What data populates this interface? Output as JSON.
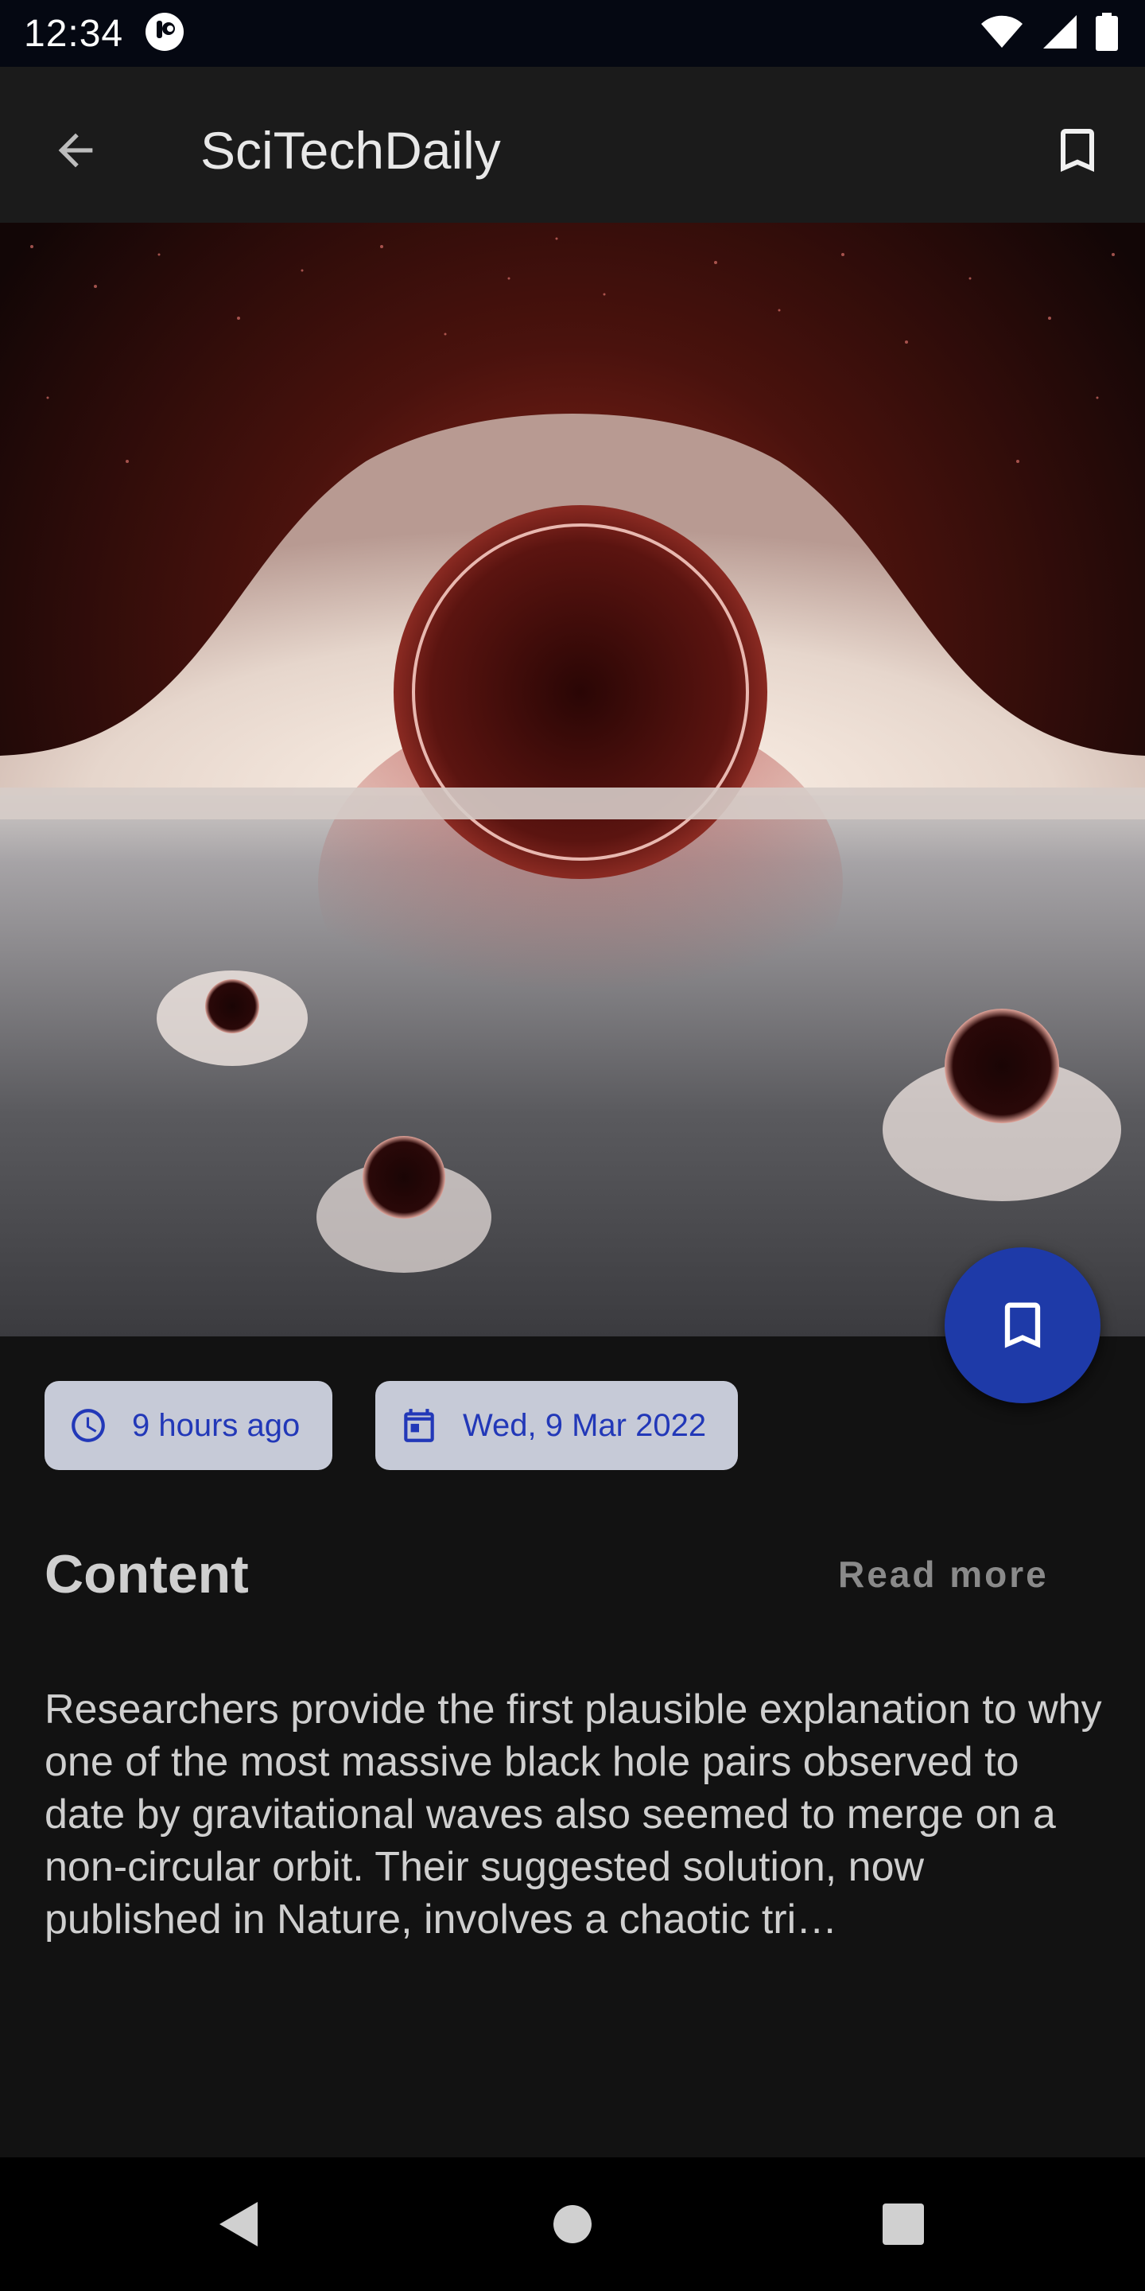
{
  "status_bar": {
    "time": "12:34",
    "icons": [
      "media-app-icon",
      "wifi-icon",
      "signal-icon",
      "battery-icon"
    ]
  },
  "app_bar": {
    "title": "SciTechDaily",
    "back_icon": "arrow-back-icon",
    "bookmark_icon": "bookmark-outline-icon"
  },
  "hero": {
    "image_subject": "black hole illustration"
  },
  "fab": {
    "icon": "bookmark-outline-icon",
    "color": "#1e3aa8"
  },
  "chips": {
    "time": {
      "label": "9 hours ago",
      "icon": "clock-icon"
    },
    "date": {
      "label": "Wed, 9 Mar 2022",
      "icon": "calendar-icon"
    }
  },
  "content": {
    "title": "Content",
    "read_more": "Read more",
    "text": "Researchers provide the first plausible explanation to why one of the most massive black hole pairs observed to date by gravitational waves also seemed to merge on a non-circular orbit. Their suggested solution, now published in Nature, involves a chaotic tri…"
  },
  "nav_bar": {
    "back": "nav-back-icon",
    "home": "nav-home-icon",
    "recents": "nav-recents-icon"
  },
  "colors": {
    "background": "#121212",
    "app_bar": "#1b1b1b",
    "chip_bg": "#c6cad7",
    "chip_text": "#2238b8",
    "accent": "#1e3aa8"
  }
}
